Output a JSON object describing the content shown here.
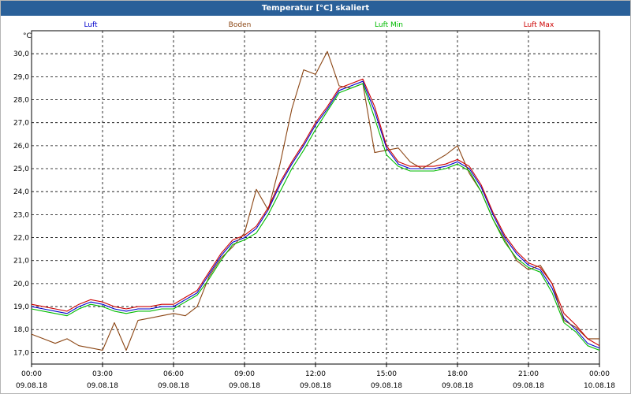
{
  "window": {
    "title": "Temperatur [°C] skaliert"
  },
  "chart_data": {
    "type": "line",
    "title": "Temperatur [°C] skaliert",
    "ylabel": "°C",
    "xlabel": "",
    "ylim": [
      16.5,
      31.0
    ],
    "xlim": [
      0,
      24
    ],
    "grid": true,
    "legend_position": "top",
    "y_ticks": [
      "17,0",
      "18,0",
      "19,0",
      "20,0",
      "21,0",
      "22,0",
      "23,0",
      "24,0",
      "25,0",
      "26,0",
      "27,0",
      "28,0",
      "29,0",
      "30,0"
    ],
    "x_ticks": [
      {
        "time": "00:00",
        "date": "09.08.18"
      },
      {
        "time": "03:00",
        "date": "09.08.18"
      },
      {
        "time": "06:00",
        "date": "09.08.18"
      },
      {
        "time": "09:00",
        "date": "09.08.18"
      },
      {
        "time": "12:00",
        "date": "09.08.18"
      },
      {
        "time": "15:00",
        "date": "09.08.18"
      },
      {
        "time": "18:00",
        "date": "09.08.18"
      },
      {
        "time": "21:00",
        "date": "09.08.18"
      },
      {
        "time": "00:00",
        "date": "10.08.18"
      }
    ],
    "x_hours": [
      0,
      0.5,
      1,
      1.5,
      2,
      2.5,
      3,
      3.5,
      4,
      4.5,
      5,
      5.5,
      6,
      6.5,
      7,
      7.5,
      8,
      8.5,
      9,
      9.5,
      10,
      10.5,
      11,
      11.5,
      12,
      12.5,
      13,
      13.5,
      14,
      14.5,
      15,
      15.5,
      16,
      16.5,
      17,
      17.5,
      18,
      18.5,
      19,
      19.5,
      20,
      20.5,
      21,
      21.5,
      22,
      22.5,
      23,
      23.5,
      24
    ],
    "series": [
      {
        "name": "Luft",
        "color": "#0000cc",
        "values": [
          19.0,
          18.9,
          18.8,
          18.7,
          19.0,
          19.2,
          19.1,
          18.9,
          18.8,
          18.9,
          18.9,
          19.0,
          19.0,
          19.3,
          19.6,
          20.4,
          21.2,
          21.8,
          22.0,
          22.4,
          23.2,
          24.3,
          25.2,
          26.0,
          26.9,
          27.6,
          28.4,
          28.6,
          28.8,
          27.5,
          25.9,
          25.2,
          25.0,
          25.0,
          25.0,
          25.1,
          25.3,
          25.0,
          24.2,
          23.0,
          22.0,
          21.3,
          20.8,
          20.6,
          19.8,
          18.5,
          18.0,
          17.4,
          17.2
        ]
      },
      {
        "name": "Boden",
        "color": "#8b4513",
        "values": [
          17.8,
          17.6,
          17.4,
          17.6,
          17.3,
          17.2,
          17.1,
          18.3,
          17.1,
          18.4,
          18.5,
          18.6,
          18.7,
          18.6,
          19.0,
          20.3,
          21.1,
          21.6,
          22.2,
          24.1,
          23.2,
          25.2,
          27.6,
          29.3,
          29.1,
          30.1,
          28.6,
          28.5,
          28.7,
          25.7,
          25.8,
          25.9,
          25.3,
          25.0,
          25.3,
          25.6,
          26.0,
          24.8,
          24.0,
          22.8,
          21.9,
          21.0,
          20.6,
          20.8,
          20.0,
          18.4,
          18.1,
          17.6,
          17.6
        ]
      },
      {
        "name": "Luft Min",
        "color": "#00bb00",
        "values": [
          18.9,
          18.8,
          18.7,
          18.6,
          18.9,
          19.1,
          19.0,
          18.8,
          18.7,
          18.8,
          18.8,
          18.9,
          18.9,
          19.2,
          19.5,
          20.2,
          21.0,
          21.7,
          21.9,
          22.2,
          23.0,
          24.0,
          25.0,
          25.8,
          26.7,
          27.5,
          28.3,
          28.5,
          28.7,
          27.2,
          25.6,
          25.1,
          24.9,
          24.9,
          24.9,
          25.0,
          25.2,
          24.9,
          24.0,
          22.8,
          21.8,
          21.1,
          20.7,
          20.5,
          19.6,
          18.3,
          17.9,
          17.3,
          17.1
        ]
      },
      {
        "name": "Luft Max",
        "color": "#cc0000",
        "values": [
          19.1,
          19.0,
          18.9,
          18.8,
          19.1,
          19.3,
          19.2,
          19.0,
          18.9,
          19.0,
          19.0,
          19.1,
          19.1,
          19.4,
          19.7,
          20.5,
          21.3,
          21.9,
          22.1,
          22.5,
          23.3,
          24.4,
          25.3,
          26.1,
          27.0,
          27.7,
          28.5,
          28.7,
          28.9,
          27.7,
          26.0,
          25.3,
          25.1,
          25.1,
          25.1,
          25.2,
          25.4,
          25.1,
          24.3,
          23.1,
          22.1,
          21.4,
          20.9,
          20.7,
          20.0,
          18.7,
          18.2,
          17.6,
          17.3
        ]
      }
    ]
  }
}
